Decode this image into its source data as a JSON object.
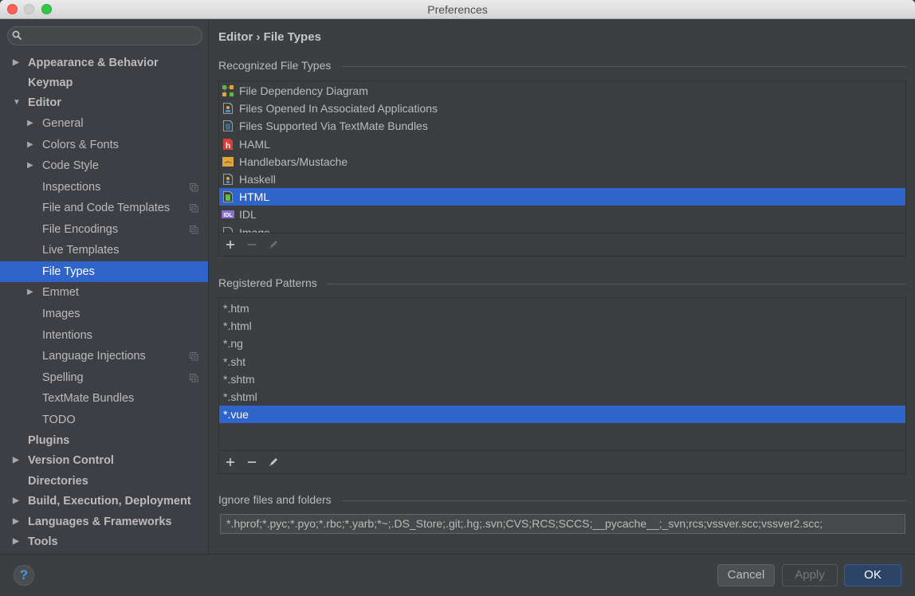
{
  "window": {
    "title": "Preferences"
  },
  "sidebar": {
    "search": {
      "placeholder": "",
      "value": ""
    },
    "items": [
      {
        "label": "Appearance & Behavior",
        "level": 0,
        "expandable": true,
        "expanded": false,
        "bold": true
      },
      {
        "label": "Keymap",
        "level": 0,
        "expandable": false,
        "bold": true
      },
      {
        "label": "Editor",
        "level": 0,
        "expandable": true,
        "expanded": true,
        "bold": true
      },
      {
        "label": "General",
        "level": 1,
        "expandable": true,
        "expanded": false
      },
      {
        "label": "Colors & Fonts",
        "level": 1,
        "expandable": true,
        "expanded": false
      },
      {
        "label": "Code Style",
        "level": 1,
        "expandable": true,
        "expanded": false
      },
      {
        "label": "Inspections",
        "level": 1,
        "project_icon": true
      },
      {
        "label": "File and Code Templates",
        "level": 1,
        "project_icon": true
      },
      {
        "label": "File Encodings",
        "level": 1,
        "project_icon": true
      },
      {
        "label": "Live Templates",
        "level": 1
      },
      {
        "label": "File Types",
        "level": 1,
        "selected": true
      },
      {
        "label": "Emmet",
        "level": 1,
        "expandable": true,
        "expanded": false
      },
      {
        "label": "Images",
        "level": 1
      },
      {
        "label": "Intentions",
        "level": 1
      },
      {
        "label": "Language Injections",
        "level": 1,
        "project_icon": true
      },
      {
        "label": "Spelling",
        "level": 1,
        "project_icon": true
      },
      {
        "label": "TextMate Bundles",
        "level": 1
      },
      {
        "label": "TODO",
        "level": 1
      },
      {
        "label": "Plugins",
        "level": 0,
        "bold": true
      },
      {
        "label": "Version Control",
        "level": 0,
        "expandable": true,
        "expanded": false,
        "bold": true
      },
      {
        "label": "Directories",
        "level": 0,
        "bold": true
      },
      {
        "label": "Build, Execution, Deployment",
        "level": 0,
        "expandable": true,
        "expanded": false,
        "bold": true
      },
      {
        "label": "Languages & Frameworks",
        "level": 0,
        "expandable": true,
        "expanded": false,
        "bold": true
      },
      {
        "label": "Tools",
        "level": 0,
        "expandable": true,
        "expanded": false,
        "bold": true
      }
    ]
  },
  "main": {
    "breadcrumb": "Editor › File Types",
    "recognized": {
      "title": "Recognized File Types",
      "items": [
        {
          "label": "File Dependency Diagram",
          "icon": "diagram-icon"
        },
        {
          "label": "Files Opened In Associated Applications",
          "icon": "associated-app-file-icon"
        },
        {
          "label": "Files Supported Via TextMate Bundles",
          "icon": "textmate-file-icon"
        },
        {
          "label": "HAML",
          "icon": "haml-icon"
        },
        {
          "label": "Handlebars/Mustache",
          "icon": "handlebars-icon"
        },
        {
          "label": "Haskell",
          "icon": "haskell-file-icon"
        },
        {
          "label": "HTML",
          "icon": "html-file-icon",
          "selected": true
        },
        {
          "label": "IDL",
          "icon": "idl-icon"
        },
        {
          "label": "Image",
          "icon": "image-file-icon"
        }
      ]
    },
    "patterns": {
      "title": "Registered Patterns",
      "items": [
        {
          "label": "*.htm"
        },
        {
          "label": "*.html"
        },
        {
          "label": "*.ng"
        },
        {
          "label": "*.sht"
        },
        {
          "label": "*.shtm"
        },
        {
          "label": "*.shtml"
        },
        {
          "label": "*.vue",
          "selected": true
        }
      ]
    },
    "ignore": {
      "title": "Ignore files and folders",
      "value": "*.hprof;*.pyc;*.pyo;*.rbc;*.yarb;*~;.DS_Store;.git;.hg;.svn;CVS;RCS;SCCS;__pycache__;_svn;rcs;vssver.scc;vssver2.scc;"
    }
  },
  "footer": {
    "help_label": "?",
    "cancel_label": "Cancel",
    "apply_label": "Apply",
    "ok_label": "OK"
  }
}
